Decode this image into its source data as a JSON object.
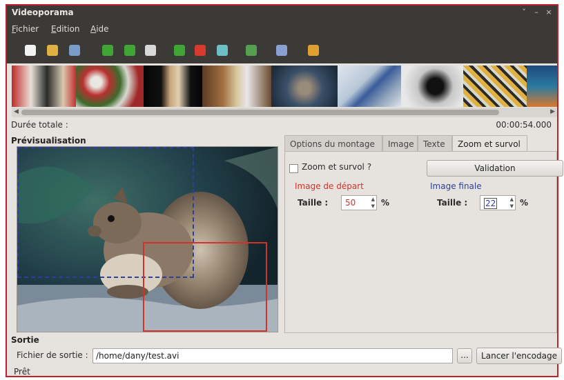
{
  "window": {
    "title": "Videoporama",
    "controls": [
      "˅",
      "–",
      "×"
    ]
  },
  "menu": {
    "items": [
      {
        "first": "F",
        "rest": "ichier"
      },
      {
        "first": "E",
        "rest": "dition"
      },
      {
        "first": "A",
        "rest": "ide"
      }
    ]
  },
  "toolbar": {
    "icons": [
      {
        "name": "new-icon",
        "color": "#f2f2f2"
      },
      {
        "name": "open-icon",
        "color": "#e0b040"
      },
      {
        "name": "save-icon",
        "color": "#7a9cc8"
      },
      {
        "name": "add-icon",
        "color": "#3fa535"
      },
      {
        "name": "arrow-right-icon",
        "color": "#3fa535"
      },
      {
        "name": "clean-icon",
        "color": "#d8d8d8"
      },
      {
        "name": "arrow-forward-icon",
        "color": "#3fa535"
      },
      {
        "name": "remove-icon",
        "color": "#d83a2e"
      },
      {
        "name": "refresh-icon",
        "color": "#6cbfc4"
      },
      {
        "name": "film-icon",
        "color": "#55a050"
      },
      {
        "name": "tools-icon",
        "color": "#8aa0d0"
      },
      {
        "name": "export-icon",
        "color": "#e0a030"
      }
    ]
  },
  "duration": {
    "label": "Durée totale :",
    "value": "00:00:54.000"
  },
  "preview": {
    "title": "Prévisualisation"
  },
  "tabs": [
    "Options du montage",
    "Image",
    "Texte",
    "Zoom et survol"
  ],
  "zoom": {
    "checkbox_label": "Zoom et survol ?",
    "validate_label": "Validation",
    "start_title": "Image de départ",
    "end_title": "Image finale",
    "size_label": "Taille :",
    "start_value": "50",
    "end_value": "22",
    "unit": "%"
  },
  "output": {
    "title": "Sortie",
    "file_label": "Fichier de sortie :",
    "file_value": "/home/dany/test.avi",
    "browse_label": "...",
    "encode_label": "Lancer l'encodage"
  },
  "status": "Prêt",
  "colors": {
    "start": "#d2322a",
    "end": "#2d3f9a",
    "chrome": "#3b3a36"
  }
}
